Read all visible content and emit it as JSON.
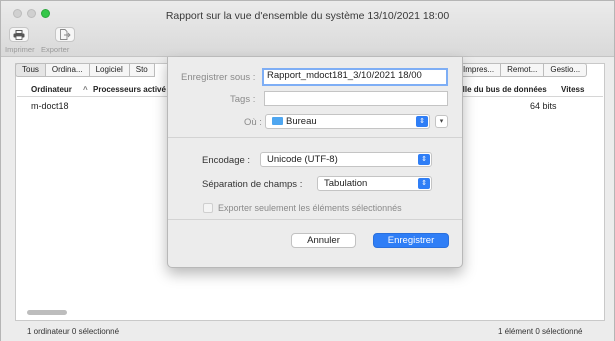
{
  "window": {
    "title": "Rapport sur la vue d'ensemble du système  13/10/2021 18:00",
    "toolbar": {
      "print_label": "Imprimer",
      "export_label": "Exporter"
    }
  },
  "tabs": {
    "left": [
      "Tous",
      "Ordina...",
      "Logiciel",
      "Sto"
    ],
    "right": [
      "Impres...",
      "Remot...",
      "Gestio..."
    ]
  },
  "table": {
    "headers": [
      "Ordinateur",
      "Processeurs activé",
      "aille du bus de données",
      "Vitess"
    ],
    "sort_indicator": "^",
    "row": {
      "name": "m-doct18",
      "bus": "64 bits"
    }
  },
  "status": {
    "left": "1 ordinateur  0 sélectionné",
    "right": "1 élément  0 sélectionné"
  },
  "dialog": {
    "save_as_label": "Enregistrer sous :",
    "save_as_value": "Rapport_mdoct181_3/10/2021 18/00",
    "tags_label": "Tags :",
    "tags_value": "",
    "where_label": "Où :",
    "where_value": "Bureau",
    "encoding_label": "Encodage :",
    "encoding_value": "Unicode (UTF-8)",
    "separator_label": "Séparation de champs :",
    "separator_value": "Tabulation",
    "export_selected_label": "Exporter seulement les éléments sélectionnés",
    "cancel_label": "Annuler",
    "save_label": "Enregistrer"
  },
  "icons": {
    "popup_arrow": "chevron-updown-icon",
    "disclose": "chevron-down-icon",
    "folder": "folder-icon"
  },
  "colors": {
    "accent": "#2f7ef6",
    "zoom_button": "#34c749"
  }
}
